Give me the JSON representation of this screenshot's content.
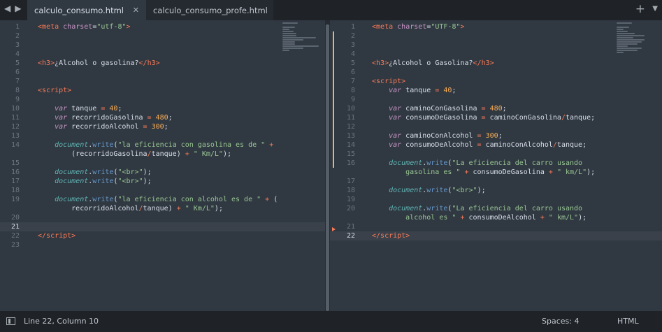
{
  "tabs": [
    {
      "label": "calculo_consumo.html",
      "active": true
    },
    {
      "label": "calculo_consumo_profe.html",
      "active": false,
      "modified": true
    }
  ],
  "status": {
    "position": "Line 22, Column 10",
    "spaces": "Spaces: 4",
    "syntax": "HTML"
  },
  "left_editor": {
    "current_line": 21,
    "lines": [
      {
        "n": "1",
        "html": "<span class='t-op'>&lt;</span><span class='t-tag'>meta</span> <span class='t-attr'>charset</span>=<span class='t-str'>\"utf-8\"</span><span class='t-op'>&gt;</span>"
      },
      {
        "n": "2",
        "html": ""
      },
      {
        "n": "3",
        "html": ""
      },
      {
        "n": "4",
        "html": ""
      },
      {
        "n": "5",
        "html": "<span class='t-op'>&lt;</span><span class='t-tag'>h3</span><span class='t-op'>&gt;</span>¿Alcohol o gasolina?<span class='t-op'>&lt;/</span><span class='t-tag'>h3</span><span class='t-op'>&gt;</span>"
      },
      {
        "n": "6",
        "html": ""
      },
      {
        "n": "7",
        "html": ""
      },
      {
        "n": "8",
        "html": "<span class='t-op'>&lt;</span><span class='t-tag'>script</span><span class='t-op'>&gt;</span>"
      },
      {
        "n": "9",
        "html": ""
      },
      {
        "n": "10",
        "html": "    <span class='t-kw'>var</span> tanque <span class='t-op'>=</span> <span class='t-num'>40</span>;"
      },
      {
        "n": "11",
        "html": "    <span class='t-kw'>var</span> recorridoGasolina <span class='t-op'>=</span> <span class='t-num'>480</span>;"
      },
      {
        "n": "12",
        "html": "    <span class='t-kw'>var</span> recorridoAlcohol <span class='t-op'>=</span> <span class='t-num'>300</span>;"
      },
      {
        "n": "13",
        "html": ""
      },
      {
        "n": "14",
        "html": "    <span class='t-obj'>document</span>.<span class='t-fn'>write</span>(<span class='t-str'>\"la eficiencia con gasolina es de \"</span> <span class='t-op'>+</span>"
      },
      {
        "n": "",
        "html": "        (recorridoGasolina<span class='t-op'>/</span>tanque) <span class='t-op'>+</span> <span class='t-str'>\" Km/L\"</span>);"
      },
      {
        "n": "15",
        "html": ""
      },
      {
        "n": "16",
        "html": "    <span class='t-obj'>document</span>.<span class='t-fn'>write</span>(<span class='t-str'>\"&lt;br&gt;\"</span>);"
      },
      {
        "n": "17",
        "html": "    <span class='t-obj'>document</span>.<span class='t-fn'>write</span>(<span class='t-str'>\"&lt;br&gt;\"</span>);"
      },
      {
        "n": "18",
        "html": ""
      },
      {
        "n": "19",
        "html": "    <span class='t-obj'>document</span>.<span class='t-fn'>write</span>(<span class='t-str'>\"la eficiencia con alcohol es de \"</span> <span class='t-op'>+</span> ("
      },
      {
        "n": "",
        "html": "        recorridoAlcohol<span class='t-op'>/</span>tanque) <span class='t-op'>+</span> <span class='t-str'>\" Km/L\"</span>);"
      },
      {
        "n": "20",
        "html": ""
      },
      {
        "n": "21",
        "html": ""
      },
      {
        "n": "22",
        "html": "<span class='t-op'>&lt;/</span><span class='t-tag'>script</span><span class='t-op'>&gt;</span>"
      },
      {
        "n": "23",
        "html": ""
      }
    ]
  },
  "right_editor": {
    "current_line": 22,
    "lines": [
      {
        "n": "1",
        "html": "<span class='t-op'>&lt;</span><span class='t-tag'>meta</span> <span class='t-attr'>charset</span>=<span class='t-str'>\"UTF-8\"</span><span class='t-op'>&gt;</span>"
      },
      {
        "n": "2",
        "html": ""
      },
      {
        "n": "3",
        "html": ""
      },
      {
        "n": "4",
        "html": ""
      },
      {
        "n": "5",
        "html": "<span class='t-op'>&lt;</span><span class='t-tag'>h3</span><span class='t-op'>&gt;</span>¿Alcohol o Gasolina?<span class='t-op'>&lt;/</span><span class='t-tag'>h3</span><span class='t-op'>&gt;</span>"
      },
      {
        "n": "6",
        "html": ""
      },
      {
        "n": "7",
        "html": "<span class='t-op'>&lt;</span><span class='t-tag'>script</span><span class='t-op'>&gt;</span>"
      },
      {
        "n": "8",
        "html": "    <span class='t-kw'>var</span> tanque <span class='t-op'>=</span> <span class='t-num'>40</span>;"
      },
      {
        "n": "9",
        "html": ""
      },
      {
        "n": "10",
        "html": "    <span class='t-kw'>var</span> caminoConGasolina <span class='t-op'>=</span> <span class='t-num'>480</span>;"
      },
      {
        "n": "11",
        "html": "    <span class='t-kw'>var</span> consumoDeGasolina <span class='t-op'>=</span> caminoConGasolina<span class='t-op'>/</span>tanque;"
      },
      {
        "n": "12",
        "html": ""
      },
      {
        "n": "13",
        "html": "    <span class='t-kw'>var</span> caminoConAlcohol <span class='t-op'>=</span> <span class='t-num'>300</span>;"
      },
      {
        "n": "14",
        "html": "    <span class='t-kw'>var</span> consumoDeAlcohol <span class='t-op'>=</span> caminoConAlcohol<span class='t-op'>/</span>tanque;"
      },
      {
        "n": "15",
        "html": ""
      },
      {
        "n": "16",
        "html": "    <span class='t-obj'>document</span>.<span class='t-fn'>write</span>(<span class='t-str'>\"La eficiencia del carro usando</span>"
      },
      {
        "n": "",
        "html": "<span class='t-str'>        gasolina es \"</span> <span class='t-op'>+</span> consumoDeGasolina <span class='t-op'>+</span> <span class='t-str'>\" km/L\"</span>);"
      },
      {
        "n": "17",
        "html": ""
      },
      {
        "n": "18",
        "html": "    <span class='t-obj'>document</span>.<span class='t-fn'>write</span>(<span class='t-str'>\"&lt;br&gt;\"</span>);"
      },
      {
        "n": "19",
        "html": ""
      },
      {
        "n": "20",
        "html": "    <span class='t-obj'>document</span>.<span class='t-fn'>write</span>(<span class='t-str'>\"La eficiencia del carro usando</span>"
      },
      {
        "n": "",
        "html": "<span class='t-str'>        alcohol es \"</span> <span class='t-op'>+</span> consumoDeAlcohol <span class='t-op'>+</span> <span class='t-str'>\" km/L\"</span>);"
      },
      {
        "n": "21",
        "html": ""
      },
      {
        "n": "22",
        "html": "<span class='t-op'>&lt;/</span><span class='t-tag'>script</span><span class='t-op'>&gt;</span>"
      }
    ]
  }
}
